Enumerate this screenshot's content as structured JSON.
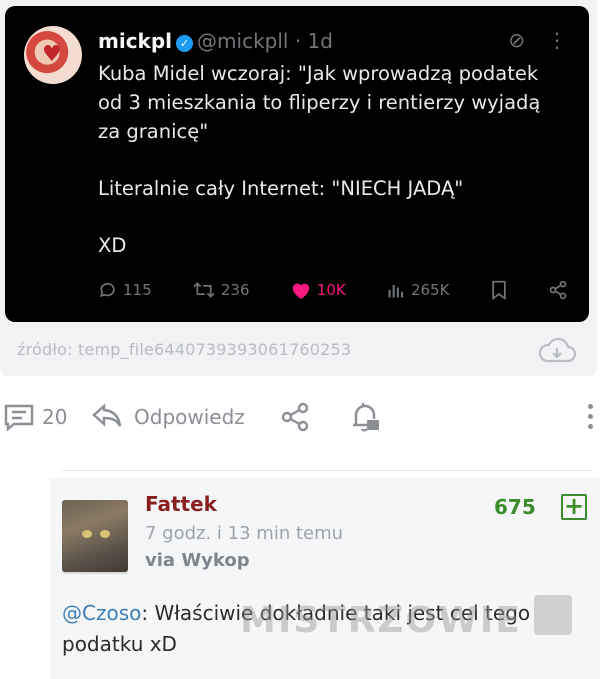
{
  "tweet": {
    "display_name": "mickpl",
    "handle": "@mickpll",
    "age": "· 1d",
    "lines": [
      "Kuba Midel wczoraj: \"Jak wprowadzą podatek",
      "od 3 mieszkania to fliperzy i rentierzy wyjadą",
      "za granicę\"",
      "",
      "Literalnie cały Internet: \"NIECH JADĄ\"",
      "",
      "XD"
    ],
    "stats": {
      "replies": "115",
      "retweets": "236",
      "likes": "10K",
      "views": "265K"
    },
    "icons": [
      "grok-icon",
      "more-icon",
      "reply-icon",
      "retweet-icon",
      "heart-icon",
      "views-icon",
      "bookmark-icon",
      "share-icon",
      "verified-badge-icon"
    ],
    "colors": {
      "bg": "#000000",
      "like": "#f91880",
      "verified": "#1d9bf0"
    }
  },
  "source": "źródło: temp_file6440739393061760253",
  "actions": {
    "comments_count": "20",
    "reply_label": "Odpowiedz"
  },
  "comment": {
    "author": "Fattek",
    "time": "7 godz. i 13 min temu",
    "via": "via Wykop",
    "score": "675",
    "plus_label": "+",
    "mention": "@Czoso",
    "text_after_mention": ": Właściwie dokładnie taki jest cel tego podatku xD",
    "colors": {
      "author": "#8a1f1f",
      "score": "#3b8c2a",
      "mention": "#3e7fb8"
    }
  },
  "watermark": "MISTRZOWIE"
}
